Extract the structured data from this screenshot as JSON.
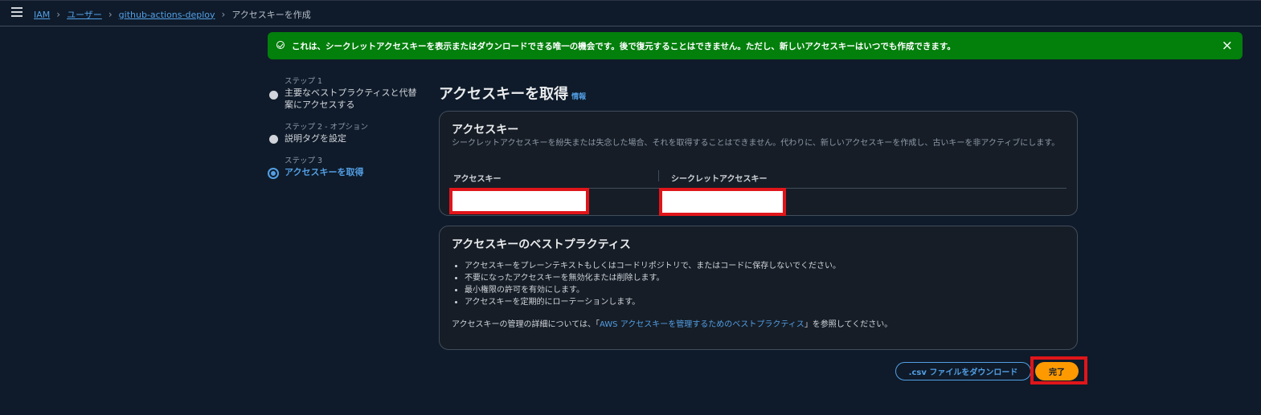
{
  "breadcrumb": {
    "items": [
      "IAM",
      "ユーザー",
      "github-actions-deploy"
    ],
    "current": "アクセスキーを作成"
  },
  "flash": {
    "message": "これは、シークレットアクセスキーを表示またはダウンロードできる唯一の機会です。後で復元することはできません。ただし、新しいアクセスキーはいつでも作成できます。",
    "close_icon": "×",
    "color": "#037f0c"
  },
  "steps": [
    {
      "label": "ステップ 1",
      "title": "主要なベストプラクティスと代替案にアクセスする"
    },
    {
      "label": "ステップ 2 - オプション",
      "title": "説明タグを設定"
    },
    {
      "label": "ステップ 3",
      "title": "アクセスキーを取得"
    }
  ],
  "page": {
    "title": "アクセスキーを取得",
    "info": "情報"
  },
  "access_key_card": {
    "title": "アクセスキー",
    "description": "シークレットアクセスキーを紛失または失念した場合、それを取得することはできません。代わりに、新しいアクセスキーを作成し、古いキーを非アクティブにします。",
    "col_access_key": "アクセスキー",
    "col_secret_key": "シークレットアクセスキー"
  },
  "best_practices_card": {
    "title": "アクセスキーのベストプラクティス",
    "items": [
      "アクセスキーをプレーンテキストもしくはコードリポジトリで、またはコードに保存しないでください。",
      "不要になったアクセスキーを無効化または削除します。",
      "最小権限の許可を有効にします。",
      "アクセスキーを定期的にローテーションします。"
    ],
    "ref_prefix": "アクセスキーの管理の詳細については、「",
    "ref_link": "AWS アクセスキーを管理するためのベストプラクティス",
    "ref_suffix": "」を参照してください。"
  },
  "actions": {
    "download_csv": ".csv ファイルをダウンロード",
    "done": "完了"
  },
  "colors": {
    "accent": "#539fe5",
    "primary_button": "#ff9900",
    "highlight": "#e0151a"
  }
}
